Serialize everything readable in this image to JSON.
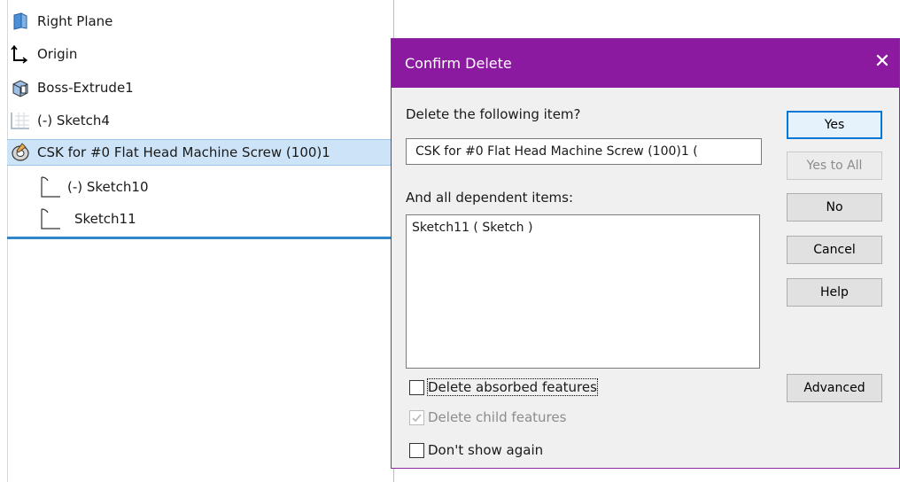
{
  "tree": {
    "items": [
      {
        "label": "Right Plane",
        "icon": "plane-icon"
      },
      {
        "label": "Origin",
        "icon": "origin-icon"
      },
      {
        "label": "Boss-Extrude1",
        "icon": "extrude-icon"
      },
      {
        "label": "(-) Sketch4",
        "icon": "sketch-icon"
      },
      {
        "label": "CSK for #0 Flat Head Machine Screw (100)1",
        "icon": "hole-wizard-icon",
        "selected": true
      },
      {
        "label": "(-) Sketch10",
        "icon": "sketch-icon"
      },
      {
        "label": "Sketch11",
        "icon": "sketch-icon"
      }
    ]
  },
  "dialog": {
    "title": "Confirm Delete",
    "close_glyph": "✕",
    "question": "Delete the following item?",
    "item_value": "CSK for #0 Flat Head Machine Screw (100)1 (",
    "dependents_label": "And all dependent items:",
    "dependents": [
      "Sketch11 ( Sketch )"
    ],
    "checkboxes": {
      "delete_absorbed": {
        "label": "Delete absorbed features",
        "checked": false
      },
      "delete_child": {
        "label": "Delete child features",
        "checked": true,
        "disabled": true
      },
      "dont_show": {
        "label": "Don't show again",
        "checked": false
      }
    },
    "buttons": {
      "yes": "Yes",
      "yes_to_all": "Yes to All",
      "no": "No",
      "cancel": "Cancel",
      "help": "Help",
      "advanced": "Advanced"
    },
    "colors": {
      "titlebar": "#8c1aa0",
      "default_button_border": "#0078d7"
    }
  }
}
